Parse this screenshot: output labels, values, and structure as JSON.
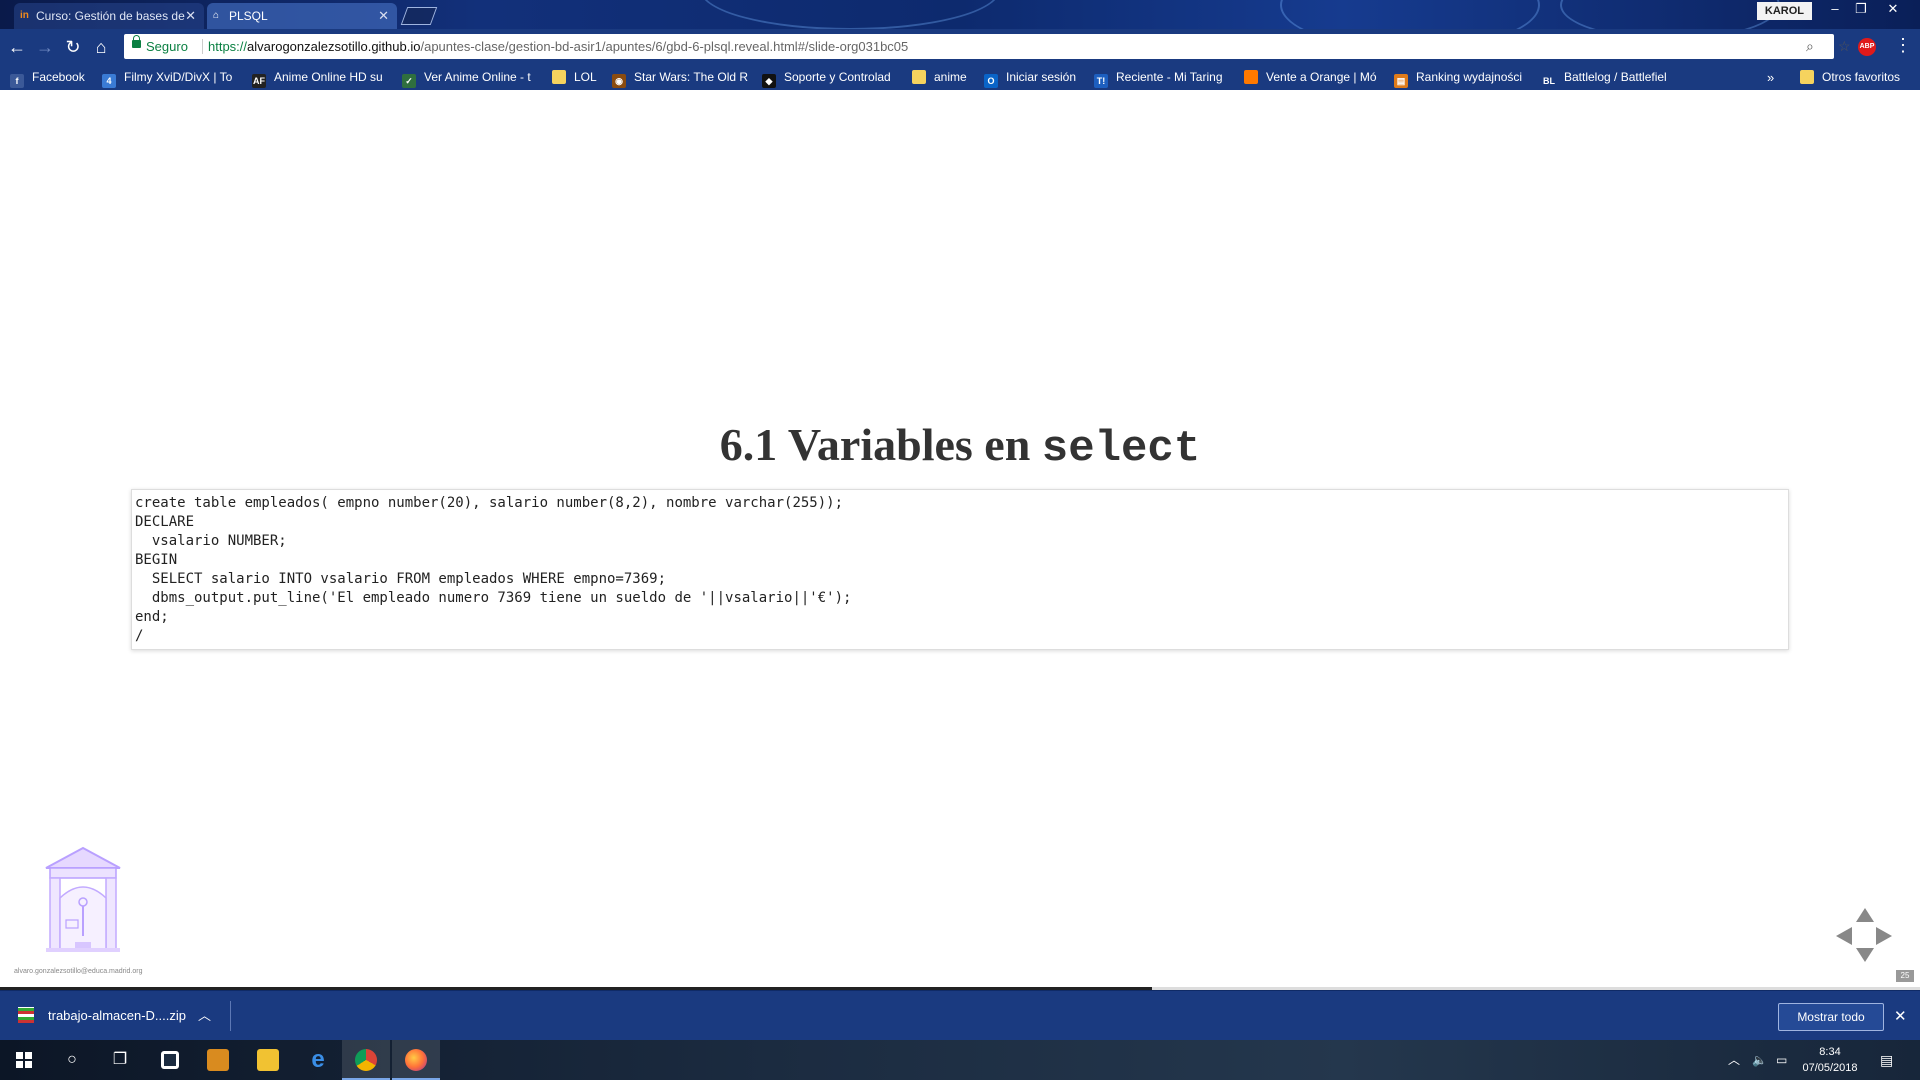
{
  "browser": {
    "tabs": [
      {
        "title": "Curso: Gestión de bases de",
        "favicon": "in"
      },
      {
        "title": "PLSQL"
      }
    ],
    "profile_name": "KAROL",
    "omnibox": {
      "secure_label": "Seguro",
      "url_scheme": "https://",
      "url_host": "alvarogonzalezsotillo.github.io",
      "url_path": "/apuntes-clase/gestion-bd-asir1/apuntes/6/gbd-6-plsql.reveal.html#/slide-org031bc05"
    },
    "extension_label": "ABP",
    "bookmarks": [
      {
        "label": "Facebook",
        "icon": "f",
        "color": "#3b5998"
      },
      {
        "label": "Filmy XviD/DivX | To",
        "icon": "4",
        "color": "#3a7bd5"
      },
      {
        "label": "Anime Online HD su",
        "icon": "AF",
        "color": "#222222"
      },
      {
        "label": "Ver Anime Online - t",
        "icon": "✓",
        "color": "#2f6f3f"
      },
      {
        "label": "LOL",
        "icon": "",
        "color": "#f6d35e"
      },
      {
        "label": "Star Wars: The Old R",
        "icon": "◉",
        "color": "#8a4b0f"
      },
      {
        "label": "Soporte y Controlad",
        "icon": "◆",
        "color": "#111111"
      },
      {
        "label": "anime",
        "icon": "",
        "color": "#f6d35e"
      },
      {
        "label": "Iniciar sesión",
        "icon": "O",
        "color": "#0a64c8"
      },
      {
        "label": "Reciente - Mi Taring",
        "icon": "T!",
        "color": "#1d5fc0"
      },
      {
        "label": "Vente a Orange | Mó",
        "icon": "",
        "color": "#ff7900"
      },
      {
        "label": "Ranking wydajności",
        "icon": "▤",
        "color": "#e07b1a"
      },
      {
        "label": "Battlelog / Battlefiel",
        "icon": "BL",
        "color": "#1a3a80"
      }
    ],
    "bookmarks_more": "»",
    "other_bookmarks": "Otros favoritos"
  },
  "slide": {
    "title_text": "6.1 Variables en ",
    "title_code": "select",
    "code_lines": [
      "create table empleados( empno number(20), salario number(8,2), nombre varchar(255));",
      "DECLARE",
      "  vsalario NUMBER;",
      "BEGIN",
      "  SELECT salario INTO vsalario FROM empleados WHERE empno=7369;",
      "  dbms_output.put_line('El empleado numero 7369 tiene un sueldo de '||vsalario||'€');",
      "end;",
      "/"
    ],
    "author_email": "alvaro.gonzalezsotillo@educa.madrid.org",
    "slide_number": "25",
    "progress_fraction": 0.6
  },
  "downloads": {
    "file_name": "trabajo-almacen-D....zip",
    "show_all_label": "Mostrar todo"
  },
  "taskbar": {
    "time": "8:34",
    "date": "07/05/2018"
  }
}
